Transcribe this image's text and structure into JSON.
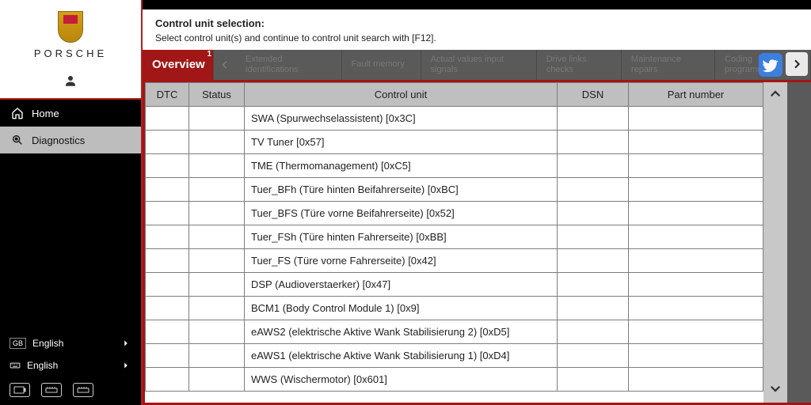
{
  "brand": {
    "wordmark": "PORSCHE"
  },
  "nav": {
    "home": "Home",
    "diagnostics": "Diagnostics"
  },
  "lang": {
    "gb": "GB",
    "label1": "English",
    "label2": "English"
  },
  "instructions": {
    "title": "Control unit selection:",
    "sub": "Select control unit(s) and continue to control unit search with [F12]."
  },
  "tabs": {
    "overview": "Overview",
    "overview_badge": "1",
    "ext_id": "Extended identifications",
    "fault": "Fault memory",
    "actual": "Actual values input signals",
    "drive": "Drive links checks",
    "maint": "Maintenance repairs",
    "coding": "Coding programming"
  },
  "columns": {
    "dtc": "DTC",
    "status": "Status",
    "cu": "Control unit",
    "dsn": "DSN",
    "pn": "Part number"
  },
  "rows": [
    {
      "cu": "SWA (Spurwechselassistent) [0x3C]"
    },
    {
      "cu": "TV Tuner [0x57]"
    },
    {
      "cu": "TME (Thermomanagement) [0xC5]"
    },
    {
      "cu": "Tuer_BFh (Türe hinten Beifahrerseite) [0xBC]"
    },
    {
      "cu": "Tuer_BFS (Türe vorne Beifahrerseite) [0x52]"
    },
    {
      "cu": "Tuer_FSh (Türe hinten Fahrerseite) [0xBB]"
    },
    {
      "cu": "Tuer_FS (Türe vorne Fahrerseite) [0x42]"
    },
    {
      "cu": "DSP (Audioverstaerker) [0x47]"
    },
    {
      "cu": "BCM1 (Body Control Module 1) [0x9]"
    },
    {
      "cu": "eAWS2 (elektrische Aktive Wank Stabilisierung 2) [0xD5]"
    },
    {
      "cu": "eAWS1 (elektrische Aktive Wank Stabilisierung 1) [0xD4]"
    },
    {
      "cu": "WWS (Wischermotor) [0x601]"
    }
  ]
}
